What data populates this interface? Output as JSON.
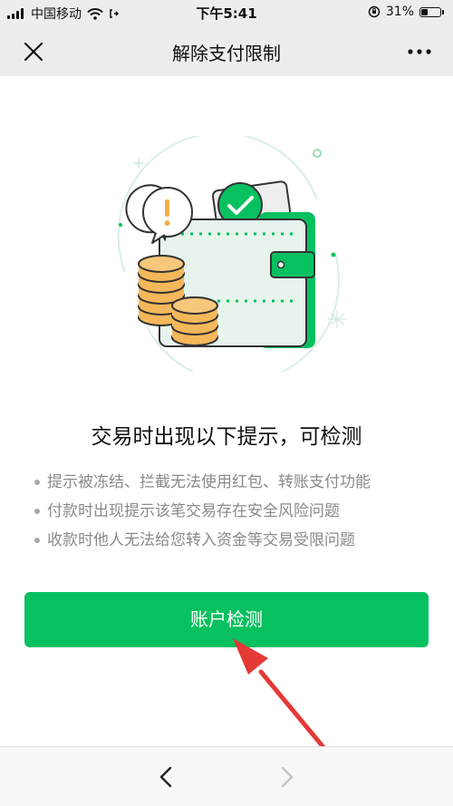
{
  "status_bar": {
    "carrier": "中国移动",
    "time": "下午5:41",
    "battery": "31%",
    "battery_level": 0.31
  },
  "nav": {
    "title": "解除支付限制",
    "close_icon": "close-icon",
    "more_icon": "more-icon"
  },
  "content": {
    "headline": "交易时出现以下提示，可检测",
    "tips": [
      "提示被冻结、拦截无法使用红包、转账支付功能",
      "付款时出现提示该笔交易存在安全风险问题",
      "收款时他人无法给您转入资金等交易受限问题"
    ],
    "button_label": "账户检测"
  },
  "colors": {
    "accent": "#07c160",
    "arrow": "#e53935"
  },
  "bottom_nav": {
    "back_icon": "chevron-left-icon",
    "forward_icon": "chevron-right-icon"
  }
}
